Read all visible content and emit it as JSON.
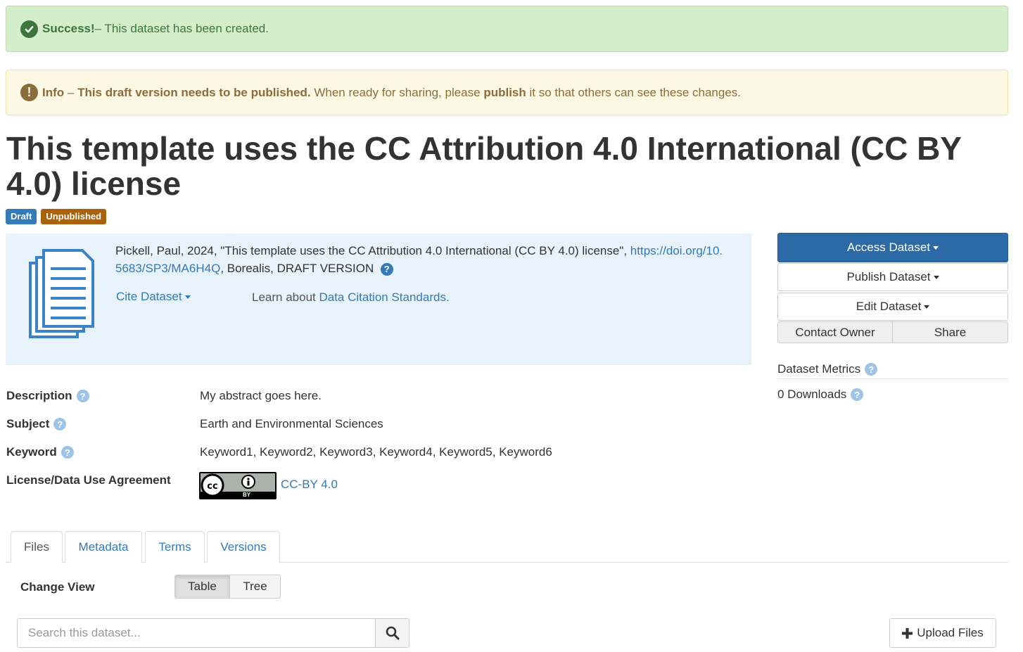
{
  "alerts": {
    "success": {
      "label": "Success!",
      "message": " – This dataset has been created."
    },
    "info": {
      "label": "Info",
      "dash": " – ",
      "strong": "This draft version needs to be published.",
      "pre": " When ready for sharing, please ",
      "action": "publish",
      "post": " it so that others can see these changes."
    }
  },
  "dataset": {
    "title": "This template uses the CC Attribution 4.0 International (CC BY 4.0) license",
    "badges": {
      "draft": "Draft",
      "unpublished": "Unpublished"
    }
  },
  "citation": {
    "text": "Pickell, Paul, 2024, \"This template uses the CC Attribution 4.0 International (CC BY 4.0) license\", ",
    "doi_line1": "https://doi.org/10.",
    "doi_line2": "5683/SP3/MA6H4Q",
    "suffix": ", Borealis, DRAFT VERSION ",
    "cite_button": "Cite Dataset",
    "learn_prefix": "Learn about ",
    "learn_link": "Data Citation Standards."
  },
  "actions": {
    "access": "Access Dataset",
    "publish": "Publish Dataset",
    "edit": "Edit Dataset",
    "contact": "Contact Owner",
    "share": "Share"
  },
  "metrics": {
    "label": "Dataset Metrics",
    "downloads": "0 Downloads"
  },
  "metadata": {
    "description": {
      "label": "Description",
      "value": "My abstract goes here."
    },
    "subject": {
      "label": "Subject",
      "value": "Earth and Environmental Sciences"
    },
    "keyword": {
      "label": "Keyword",
      "value": "Keyword1, Keyword2, Keyword3, Keyword4, Keyword5, Keyword6"
    },
    "license": {
      "label": "License/Data Use Agreement",
      "value": "CC-BY 4.0",
      "badge_text": "BY"
    }
  },
  "tabs": [
    "Files",
    "Metadata",
    "Terms",
    "Versions"
  ],
  "files": {
    "change_view": "Change View",
    "views": [
      "Table",
      "Tree"
    ],
    "search_placeholder": "Search this dataset...",
    "upload": "Upload Files"
  },
  "colors": {
    "primary": "#337ab7",
    "success_bg": "#d4eecb",
    "info_bg": "#fcf8e3"
  }
}
